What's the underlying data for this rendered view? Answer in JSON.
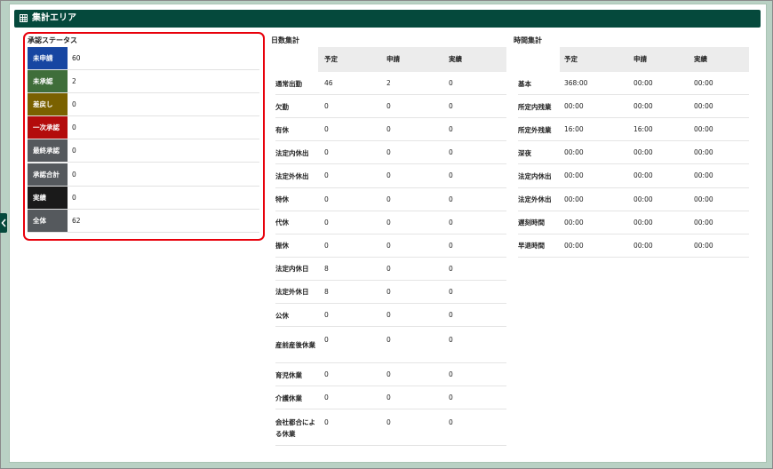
{
  "header": {
    "title": "集計エリア",
    "icon": "grid-table-icon"
  },
  "status": {
    "title": "承認ステータス",
    "items": [
      {
        "label": "未申請",
        "value": "60",
        "color": "#1746a2"
      },
      {
        "label": "未承認",
        "value": "2",
        "color": "#3f6e3a"
      },
      {
        "label": "差戻し",
        "value": "0",
        "color": "#7a6100"
      },
      {
        "label": "一次承認",
        "value": "0",
        "color": "#b30c0c"
      },
      {
        "label": "最終承認",
        "value": "0",
        "color": "#55595d"
      },
      {
        "label": "承認合計",
        "value": "0",
        "color": "#55595d"
      },
      {
        "label": "実績",
        "value": "0",
        "color": "#1a1a1a"
      },
      {
        "label": "全体",
        "value": "62",
        "color": "#55595d"
      }
    ]
  },
  "days": {
    "title": "日数集計",
    "headers": [
      "予定",
      "申請",
      "実績"
    ],
    "rows": [
      {
        "label": "通常出勤",
        "values": [
          "46",
          "2",
          "0"
        ]
      },
      {
        "label": "欠勤",
        "values": [
          "0",
          "0",
          "0"
        ]
      },
      {
        "label": "有休",
        "values": [
          "0",
          "0",
          "0"
        ]
      },
      {
        "label": "法定内休出",
        "values": [
          "0",
          "0",
          "0"
        ]
      },
      {
        "label": "法定外休出",
        "values": [
          "0",
          "0",
          "0"
        ]
      },
      {
        "label": "特休",
        "values": [
          "0",
          "0",
          "0"
        ]
      },
      {
        "label": "代休",
        "values": [
          "0",
          "0",
          "0"
        ]
      },
      {
        "label": "振休",
        "values": [
          "0",
          "0",
          "0"
        ]
      },
      {
        "label": "法定内休日",
        "values": [
          "8",
          "0",
          "0"
        ]
      },
      {
        "label": "法定外休日",
        "values": [
          "8",
          "0",
          "0"
        ]
      },
      {
        "label": "公休",
        "values": [
          "0",
          "0",
          "0"
        ]
      },
      {
        "label": "産前産後休業",
        "values": [
          "0",
          "0",
          "0"
        ]
      },
      {
        "label": "育児休業",
        "values": [
          "0",
          "0",
          "0"
        ]
      },
      {
        "label": "介護休業",
        "values": [
          "0",
          "0",
          "0"
        ]
      },
      {
        "label": "会社都合による休業",
        "values": [
          "0",
          "0",
          "0"
        ]
      }
    ]
  },
  "hours": {
    "title": "時間集計",
    "headers": [
      "予定",
      "申請",
      "実績"
    ],
    "rows": [
      {
        "label": "基本",
        "values": [
          "368:00",
          "00:00",
          "00:00"
        ]
      },
      {
        "label": "所定内残業",
        "values": [
          "00:00",
          "00:00",
          "00:00"
        ]
      },
      {
        "label": "所定外残業",
        "values": [
          "16:00",
          "16:00",
          "00:00"
        ]
      },
      {
        "label": "深夜",
        "values": [
          "00:00",
          "00:00",
          "00:00"
        ]
      },
      {
        "label": "法定内休出",
        "values": [
          "00:00",
          "00:00",
          "00:00"
        ]
      },
      {
        "label": "法定外休出",
        "values": [
          "00:00",
          "00:00",
          "00:00"
        ]
      },
      {
        "label": "遅刻時間",
        "values": [
          "00:00",
          "00:00",
          "00:00"
        ]
      },
      {
        "label": "早退時間",
        "values": [
          "00:00",
          "00:00",
          "00:00"
        ]
      }
    ]
  }
}
